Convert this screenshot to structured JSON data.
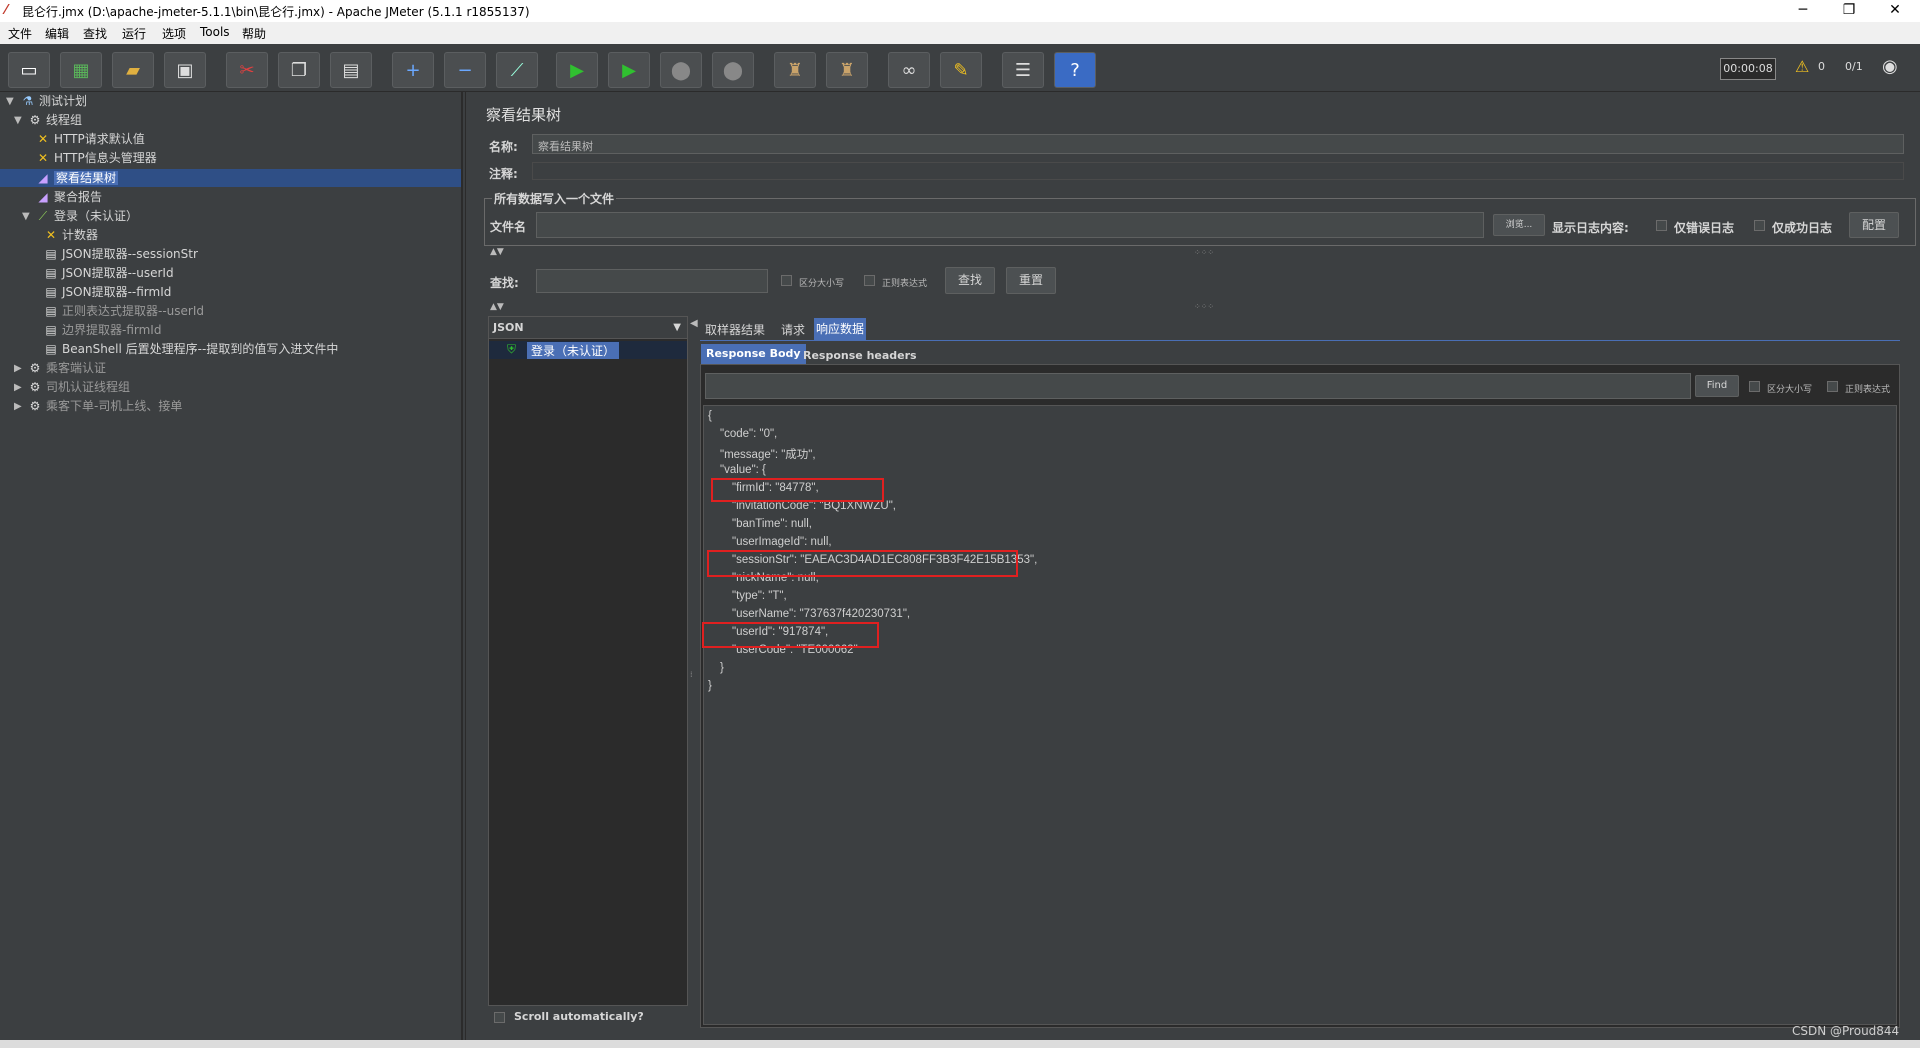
{
  "window": {
    "title": "昆仑行.jmx (D:\\apache-jmeter-5.1.1\\bin\\昆仑行.jmx) - Apache JMeter (5.1.1 r1855137)",
    "min": "─",
    "max": "❐",
    "close": "✕"
  },
  "menu": [
    "文件",
    "编辑",
    "查找",
    "运行",
    "选项",
    "Tools",
    "帮助"
  ],
  "toolbar": {
    "timer": "00:00:08",
    "warnings": "0",
    "threads": "0/1"
  },
  "tree": {
    "items": [
      {
        "label": "测试计划"
      },
      {
        "label": "线程组"
      },
      {
        "label": "HTTP请求默认值"
      },
      {
        "label": "HTTP信息头管理器"
      },
      {
        "label": "察看结果树"
      },
      {
        "label": "聚合报告"
      },
      {
        "label": "登录（未认证）"
      },
      {
        "label": "计数器"
      },
      {
        "label": "JSON提取器--sessionStr"
      },
      {
        "label": "JSON提取器--userId"
      },
      {
        "label": "JSON提取器--firmId"
      },
      {
        "label": "正则表达式提取器--userId"
      },
      {
        "label": "边界提取器-firmId"
      },
      {
        "label": "BeanShell 后置处理程序--提取到的值写入进文件中"
      },
      {
        "label": "乘客端认证"
      },
      {
        "label": "司机认证线程组"
      },
      {
        "label": "乘客下单-司机上线、接单"
      }
    ]
  },
  "panel": {
    "title": "察看结果树",
    "name_label": "名称:",
    "name_value": "察看结果树",
    "comment_label": "注释:",
    "fieldset_title": "所有数据写入一个文件",
    "filename_label": "文件名",
    "browse_button": "浏览...",
    "log_label": "显示日志内容:",
    "errors_only": "仅错误日志",
    "success_only": "仅成功日志",
    "config_button": "配置",
    "search_label": "查找:",
    "case_sensitive": "区分大小写",
    "regex": "正则表达式",
    "find_button": "查找",
    "reset_button": "重置"
  },
  "results": {
    "renderer": "JSON",
    "sample": "登录（未认证）",
    "scroll_auto": "Scroll automatically?"
  },
  "tabs": [
    "取样器结果",
    "请求",
    "响应数据"
  ],
  "subtabs": [
    "Response Body",
    "Response headers"
  ],
  "response": {
    "find_button": "Find",
    "case_sensitive": "区分大小写",
    "regex": "正则表达式",
    "lines": [
      "{",
      "\"code\": \"0\",",
      "\"message\": \"成功\",",
      "\"value\": {",
      "\"firmId\": \"84778\",",
      "\"invitationCode\": \"BQ1XNWZU\",",
      "\"banTime\": null,",
      "\"userImageId\": null,",
      "\"sessionStr\": \"EAEAC3D4AD1EC808FF3B3F42E15B1353\",",
      "\"nickName\": null,",
      "\"type\": \"T\",",
      "\"userName\": \"737637f420230731\",",
      "\"userId\": \"917874\",",
      "\"userCode\": \"TE000062\"",
      "}",
      "}"
    ]
  },
  "watermark": "CSDN @Proud844"
}
